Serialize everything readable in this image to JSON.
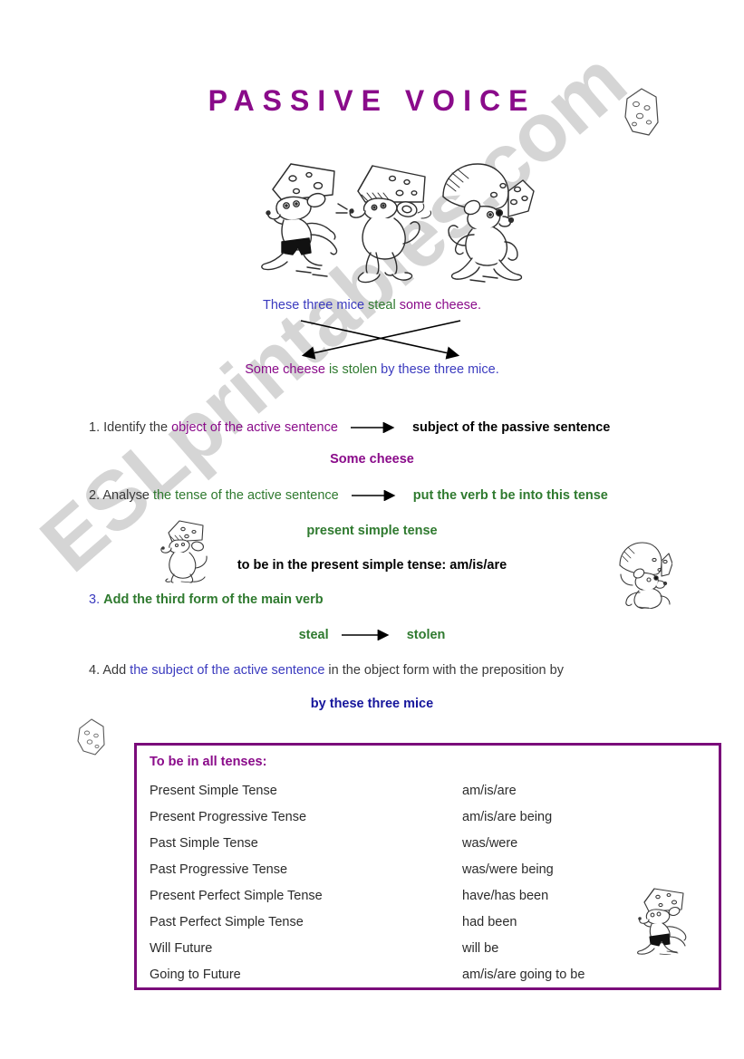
{
  "page": {
    "title": "PASSIVE VOICE",
    "watermark": "ESLprintables.com"
  },
  "example": {
    "active": {
      "subject": "These three mice ",
      "verb": "steal ",
      "object": "some cheese."
    },
    "passive": {
      "subject": "Some cheese ",
      "verb": "is stolen ",
      "agent": "by these three mice."
    }
  },
  "steps": [
    {
      "number": "1. ",
      "lead": "Identify the ",
      "highlight": "object of the active sentence",
      "result": "subject of the passive sentence",
      "example": "Some cheese"
    },
    {
      "number": "2. ",
      "lead": "Analyse ",
      "highlight": "the tense of the active sentence",
      "result": "put the verb t be into this tense",
      "example": "present simple tense",
      "note": "to be in the present simple tense: am/is/are"
    },
    {
      "number": "3. ",
      "lead": "Add the third form of the main verb",
      "from": "steal",
      "to": "stolen"
    },
    {
      "number": "4. ",
      "lead": "Add ",
      "highlight": "the subject of the active sentence",
      "tail": " in the object form with the preposition by",
      "example": "by these three mice"
    }
  ],
  "tense_box": {
    "title": "To be in all tenses:",
    "rows": [
      {
        "tense": "Present Simple Tense",
        "form": "am/is/are"
      },
      {
        "tense": "Present Progressive Tense",
        "form": "am/is/are being"
      },
      {
        "tense": "Past Simple Tense",
        "form": "was/were"
      },
      {
        "tense": "Past Progressive Tense",
        "form": "was/were being"
      },
      {
        "tense": "Present Perfect Simple Tense",
        "form": "have/has been"
      },
      {
        "tense": "Past Perfect Simple Tense",
        "form": "had been"
      },
      {
        "tense": "Will Future",
        "form": "will be"
      },
      {
        "tense": "Going to Future",
        "form": "am/is/are going to be"
      }
    ]
  },
  "colors": {
    "purple": "#8a0b8a",
    "green": "#2f7a2f",
    "blue": "#3b3bbf",
    "navy": "#16169c",
    "box_border": "#7a0b7a"
  },
  "illustrations": [
    {
      "name": "three-mice-stealing-cheese"
    },
    {
      "name": "cheese-wedge-top-right"
    },
    {
      "name": "mouse-with-cheese-left"
    },
    {
      "name": "mouse-with-cheese-right"
    },
    {
      "name": "cheese-wedge-left"
    },
    {
      "name": "mouse-with-cheese-bottom-right"
    }
  ]
}
